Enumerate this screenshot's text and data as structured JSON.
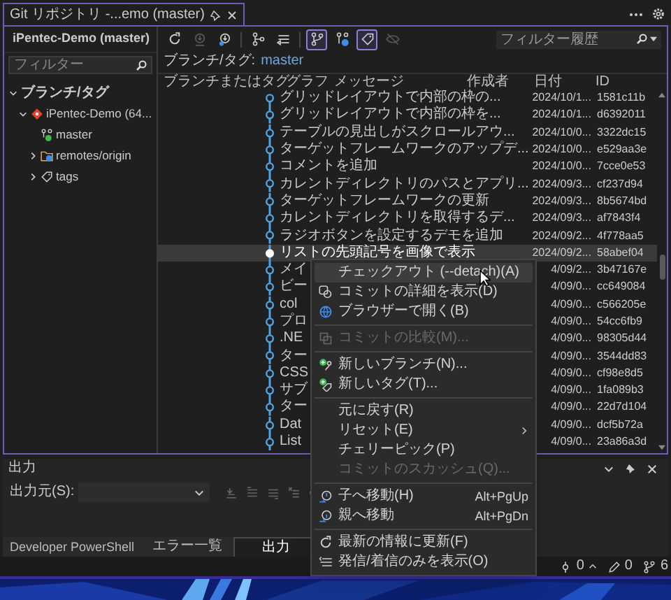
{
  "window": {
    "tab_title": "Git リポジトリ -...emo (master)"
  },
  "repo_panel": {
    "title": "iPentec-Demo (master)",
    "filter_placeholder": "フィルター",
    "tree": [
      {
        "label": "ブランチ/タグ",
        "kind": "group",
        "expanded": true,
        "children": [
          {
            "label": "iPentec-Demo (64...",
            "kind": "repo",
            "expanded": true,
            "children": [
              {
                "label": "master",
                "kind": "branch"
              },
              {
                "label": "remotes/origin",
                "kind": "folder",
                "expanded": false
              },
              {
                "label": "tags",
                "kind": "tag",
                "expanded": false
              }
            ]
          }
        ]
      }
    ]
  },
  "history": {
    "toolbar": [
      {
        "kind": "refresh",
        "disabled": false,
        "selected": false
      },
      {
        "kind": "fetch",
        "disabled": true,
        "selected": false
      },
      {
        "kind": "pull",
        "disabled": false,
        "selected": false
      },
      {
        "kind": "sep"
      },
      {
        "kind": "graph",
        "disabled": false,
        "selected": false
      },
      {
        "kind": "list",
        "disabled": false,
        "selected": false
      },
      {
        "kind": "sep"
      },
      {
        "kind": "branch",
        "disabled": false,
        "selected": true
      },
      {
        "kind": "remote",
        "disabled": false,
        "selected": false
      },
      {
        "kind": "tag",
        "disabled": false,
        "selected": true
      },
      {
        "kind": "hide",
        "disabled": true,
        "selected": false
      }
    ],
    "filter_placeholder": "フィルター履歴",
    "branch_label": "ブランチ/タグ:",
    "branch": "master",
    "columns": [
      "ブランチまたはタグ",
      "グラフ",
      "メッセージ",
      "作成者",
      "日付",
      "ID"
    ],
    "rows": [
      {
        "message": "グリッドレイアウトで内部の枠の...",
        "date": "2024/10/1...",
        "id": "1581c11b",
        "selected": false
      },
      {
        "message": "グリッドレイアウトで内部の枠を...",
        "date": "2024/10/1...",
        "id": "d6392011",
        "selected": false
      },
      {
        "message": "テーブルの見出しがスクロールアウ...",
        "date": "2024/10/0...",
        "id": "3322dc15",
        "selected": false
      },
      {
        "message": "ターゲットフレームワークのアップデ...",
        "date": "2024/10/0...",
        "id": "e529aa3e",
        "selected": false
      },
      {
        "message": "コメントを追加",
        "date": "2024/10/0...",
        "id": "7cce0e53",
        "selected": false
      },
      {
        "message": "カレントディレクトリのパスとアプリ...",
        "date": "2024/09/3...",
        "id": "cf237d94",
        "selected": false
      },
      {
        "message": "ターゲットフレームワークの更新",
        "date": "2024/09/3...",
        "id": "8b5674bd",
        "selected": false
      },
      {
        "message": "カレントディレクトリを取得するデ...",
        "date": "2024/09/3...",
        "id": "af7843f4",
        "selected": false
      },
      {
        "message": "ラジオボタンを設定するデモを追加",
        "date": "2024/09/2...",
        "id": "4f778aa5",
        "selected": false
      },
      {
        "message": "リストの先頭記号を画像で表示",
        "date": "2024/09/2...",
        "id": "58abef04",
        "selected": true
      },
      {
        "message": "メイ",
        "date": "4/09/2...",
        "id": "3b47167e",
        "selected": false
      },
      {
        "message": "ビー",
        "date": "4/09/0...",
        "id": "cc649084",
        "selected": false
      },
      {
        "message": "col",
        "date": "4/09/0...",
        "id": "c566205e",
        "selected": false
      },
      {
        "message": "プロ",
        "date": "4/09/0...",
        "id": "54cc6fb9",
        "selected": false
      },
      {
        "message": ".NE",
        "date": "4/09/0...",
        "id": "98305d44",
        "selected": false
      },
      {
        "message": "ター",
        "date": "4/09/0...",
        "id": "3544dd83",
        "selected": false
      },
      {
        "message": "CSS",
        "date": "4/09/0...",
        "id": "cf98e8d5",
        "selected": false
      },
      {
        "message": "サブ",
        "date": "4/09/0...",
        "id": "1fa089b3",
        "selected": false
      },
      {
        "message": "ター",
        "date": "4/09/0...",
        "id": "22d7d104",
        "selected": false
      },
      {
        "message": "Dat",
        "date": "4/09/0...",
        "id": "dcf5b72a",
        "selected": false
      },
      {
        "message": "List",
        "date": "4/09/0...",
        "id": "23a86a3d",
        "selected": false
      }
    ]
  },
  "context_menu": {
    "items": [
      {
        "kind": "checkout",
        "label": "チェックアウト (--detach)(A)",
        "highlighted": true,
        "disabled": false
      },
      {
        "kind": "details",
        "label": "コミットの詳細を表示(D)",
        "highlighted": false,
        "disabled": false
      },
      {
        "kind": "browser",
        "label": "ブラウザーで開く(B)",
        "highlighted": false,
        "disabled": false
      },
      {
        "kind": "separator"
      },
      {
        "kind": "compare",
        "label": "コミットの比較(M)...",
        "highlighted": false,
        "disabled": true
      },
      {
        "kind": "separator"
      },
      {
        "kind": "new-branch",
        "label": "新しいブランチ(N)...",
        "highlighted": false,
        "disabled": false
      },
      {
        "kind": "new-tag",
        "label": "新しいタグ(T)...",
        "highlighted": false,
        "disabled": false
      },
      {
        "kind": "separator"
      },
      {
        "kind": "revert",
        "label": "元に戻す(R)",
        "highlighted": false,
        "disabled": false
      },
      {
        "kind": "reset",
        "label": "リセット(E)",
        "highlighted": false,
        "disabled": false,
        "submenu": true
      },
      {
        "kind": "cherry-pick",
        "label": "チェリーピック(P)",
        "highlighted": false,
        "disabled": false
      },
      {
        "kind": "squash",
        "label": "コミットのスカッシュ(Q)...",
        "highlighted": false,
        "disabled": true
      },
      {
        "kind": "separator"
      },
      {
        "kind": "child",
        "label": "子へ移動(H)",
        "shortcut": "Alt+PgUp",
        "highlighted": false,
        "disabled": false
      },
      {
        "kind": "parent",
        "label": "親へ移動",
        "shortcut": "Alt+PgDn",
        "highlighted": false,
        "disabled": false
      },
      {
        "kind": "separator"
      },
      {
        "kind": "refresh",
        "label": "最新の情報に更新(F)",
        "highlighted": false,
        "disabled": false
      },
      {
        "kind": "in-out",
        "label": "発信/着信のみを表示(O)",
        "highlighted": false,
        "disabled": false
      }
    ]
  },
  "output": {
    "title": "出力",
    "source_label": "出力元(S):",
    "tabs": [
      {
        "label": "Developer PowerShell",
        "selected": false
      },
      {
        "label": "エラー一覧",
        "selected": false
      },
      {
        "label": "出力",
        "selected": true
      }
    ]
  },
  "status_bar": [
    {
      "kind": "push",
      "label": "0"
    },
    {
      "kind": "changes",
      "label": "0"
    },
    {
      "kind": "branches",
      "label": "6"
    }
  ]
}
